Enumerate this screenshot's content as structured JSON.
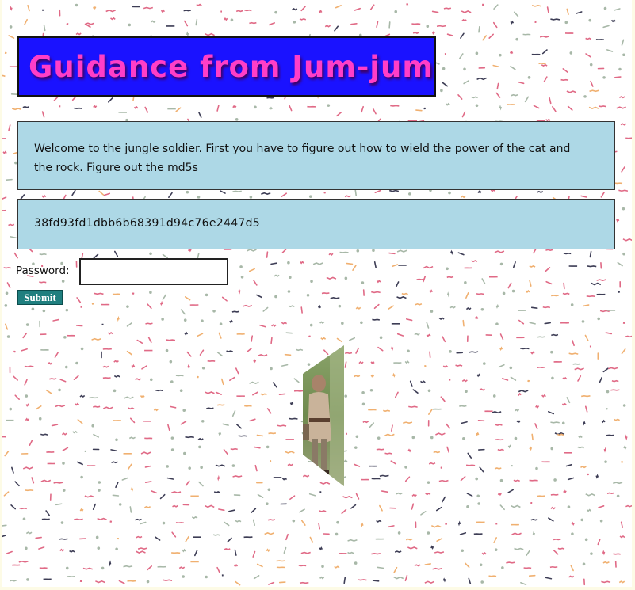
{
  "header": {
    "title": "Guidance from Jum-jum"
  },
  "welcome": {
    "text": "Welcome to the jungle soldier. First you have to figure out how to wield the power of the cat and the rock. Figure out the md5s"
  },
  "hash": {
    "value": "38fd93fd1dbb6b68391d94c76e2447d5"
  },
  "form": {
    "password_label": "Password:",
    "password_value": "",
    "submit_label": "Submit"
  },
  "colors": {
    "title_bg": "#1a12ff",
    "title_text": "#ff3ec8",
    "box_bg": "#add8e6",
    "button_bg": "#1f7f7f"
  },
  "icons": {
    "photo": "soldier-photo"
  }
}
